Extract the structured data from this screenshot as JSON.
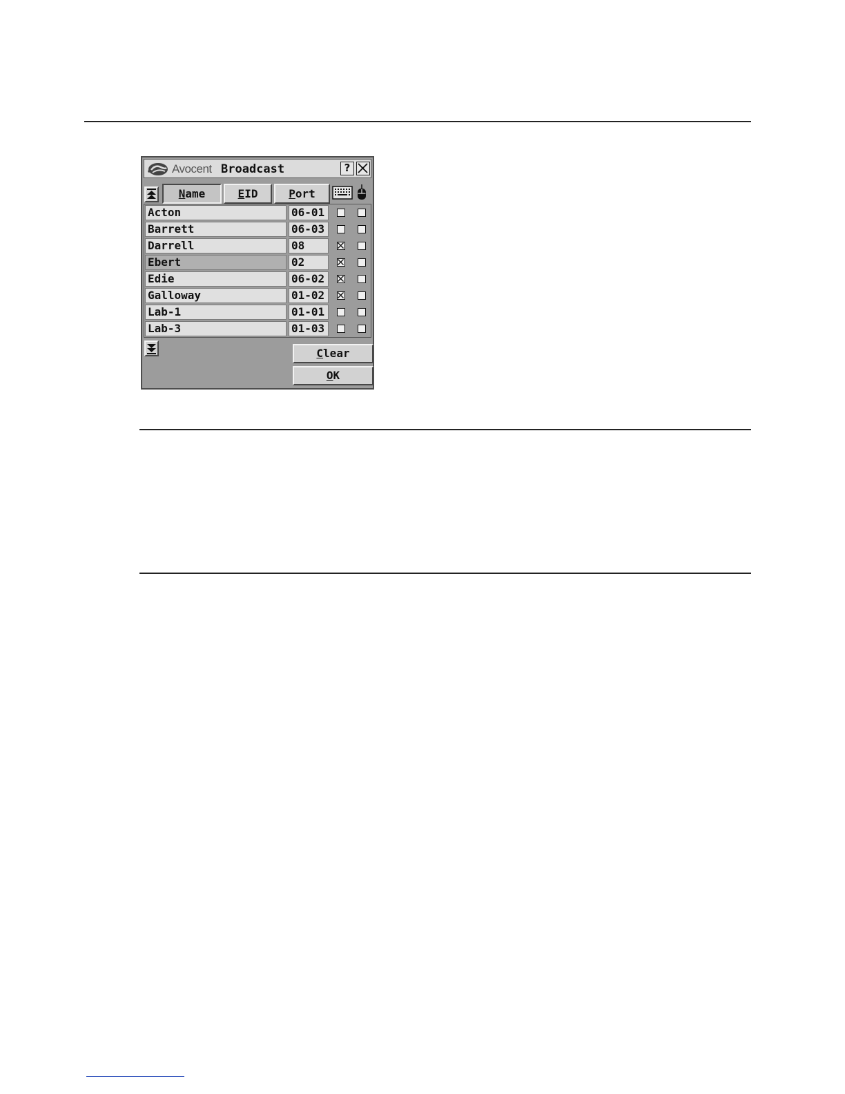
{
  "window": {
    "brand": "Avocent",
    "title": "Broadcast",
    "help_label": "?",
    "close_label": "X"
  },
  "columns": {
    "name": {
      "pre": "",
      "key": "N",
      "post": "ame"
    },
    "eid": {
      "pre": "",
      "key": "E",
      "post": "ID"
    },
    "port": {
      "pre": "",
      "key": "P",
      "post": "ort"
    }
  },
  "rows": [
    {
      "name": "Acton",
      "port": "06-01",
      "keyboard": false,
      "mouse": false
    },
    {
      "name": "Barrett",
      "port": "06-03",
      "keyboard": false,
      "mouse": false
    },
    {
      "name": "Darrell",
      "port": "08",
      "keyboard": true,
      "mouse": false
    },
    {
      "name": "Ebert",
      "port": "02",
      "keyboard": true,
      "mouse": false,
      "selected": true
    },
    {
      "name": "Edie",
      "port": "06-02",
      "keyboard": true,
      "mouse": false
    },
    {
      "name": "Galloway",
      "port": "01-02",
      "keyboard": true,
      "mouse": false
    },
    {
      "name": "Lab-1",
      "port": "01-01",
      "keyboard": false,
      "mouse": false
    },
    {
      "name": "Lab-3",
      "port": "01-03",
      "keyboard": false,
      "mouse": false
    }
  ],
  "buttons": {
    "clear": {
      "pre": "",
      "key": "C",
      "post": "lear"
    },
    "ok": {
      "pre": "",
      "key": "O",
      "post": "K"
    }
  },
  "icons": {
    "logo": "avocent-logo-icon",
    "keyboard": "keyboard-icon",
    "mouse": "mouse-icon",
    "scroll_up": "scroll-up-icon",
    "scroll_down": "scroll-down-icon"
  }
}
